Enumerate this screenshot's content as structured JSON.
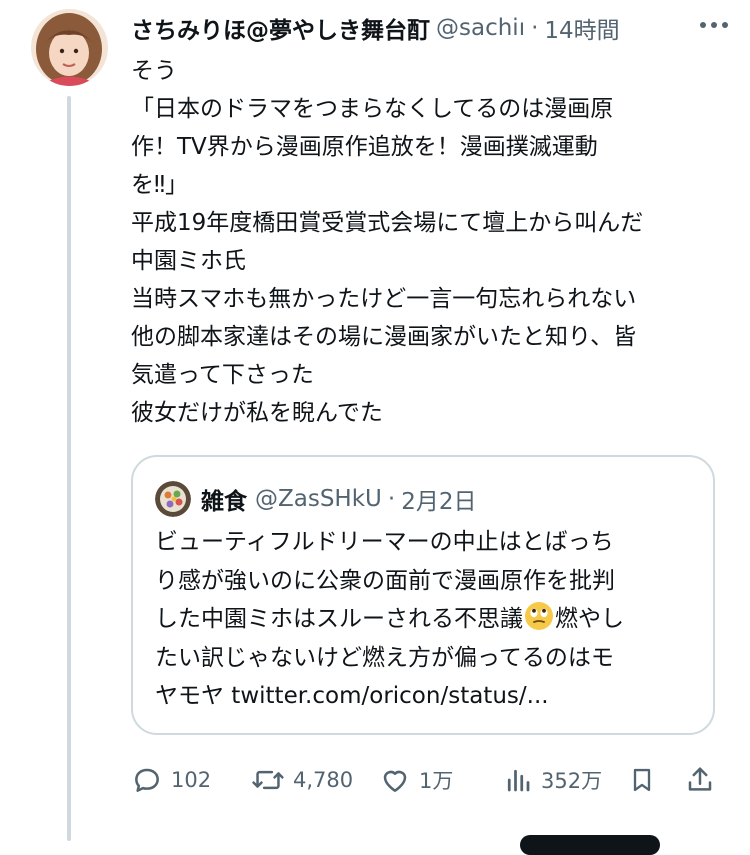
{
  "post": {
    "display_name": "さちみりほ@夢やしき舞台酊",
    "handle": "@sachiı",
    "separator": "·",
    "time": "14時間",
    "more_icon": "more-horizontal-icon",
    "lines": [
      "そう",
      "「日本のドラマをつまらなくしてるのは漫画原",
      "作！TV界から漫画原作追放を！漫画撲滅運動",
      "を‼」",
      "平成19年度橋田賞受賞式会場にて壇上から叫んだ",
      "中園ミホ氏",
      "当時スマホも無かったけど一言一句忘れられない",
      "他の脚本家達はその場に漫画家がいたと知り、皆",
      "気遣って下さった",
      "彼女だけが私を睨んでた"
    ]
  },
  "quote": {
    "display_name": "雑食",
    "handle": "@ZasSHkU",
    "separator": "·",
    "time": "2月2日",
    "line1": "ビューティフルドリーマーの中止はとばっち",
    "line2": "り感が強いのに公衆の面前で漫画原作を批判",
    "line3_before": "した中園ミホはスルーされる不思議",
    "line3_after": "燃やし",
    "line3_emoji": "face-with-rolling-eyes-emoji",
    "line4": "たい訳じゃないけど燃え方が偏ってるのはモ",
    "line5": "ヤモヤ twitter.com/oricon/status/..."
  },
  "actions": {
    "reply": {
      "icon": "reply-icon",
      "count": "102"
    },
    "repost": {
      "icon": "repost-icon",
      "count": "4,780"
    },
    "like": {
      "icon": "heart-icon",
      "count": "1万"
    },
    "views": {
      "icon": "views-icon",
      "count": "352万"
    },
    "bookmark": {
      "icon": "bookmark-icon"
    },
    "share": {
      "icon": "share-icon"
    }
  },
  "colors": {
    "text": "#0f1419",
    "secondary": "#536471",
    "border": "#cfd9de"
  }
}
